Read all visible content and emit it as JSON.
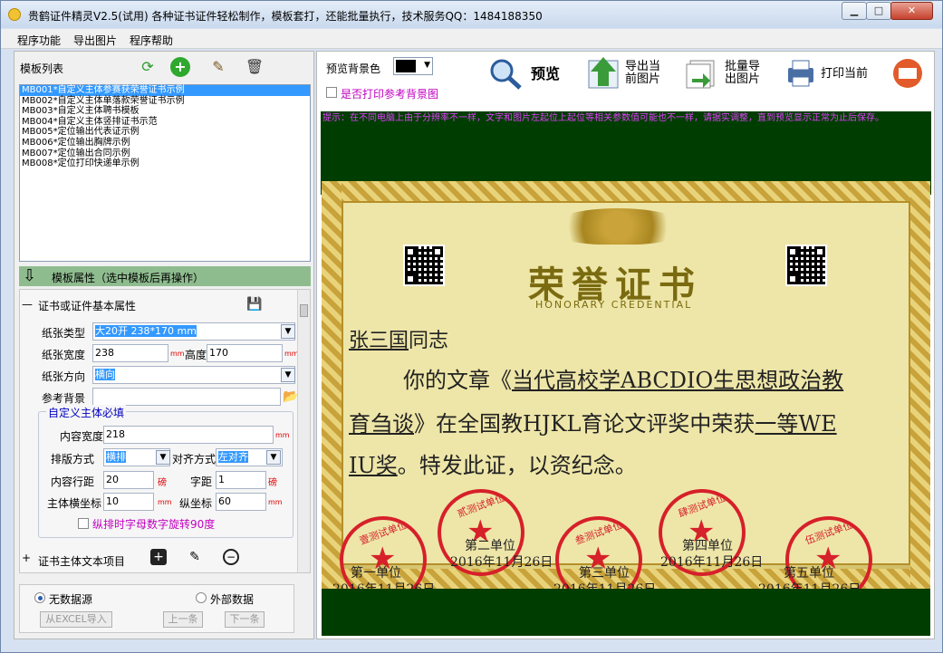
{
  "window": {
    "title": "贵鹤证件精灵V2.5(试用)     各种证书证件轻松制作，模板套打，还能批量执行，技术服务QQ：1484188350",
    "min": "▁",
    "max": "□",
    "close": "✕"
  },
  "menu": [
    "程序功能",
    "导出图片",
    "程序帮助"
  ],
  "templates": {
    "header": "模板列表",
    "items": [
      "MB001*自定义主体参赛获荣誉证书示例",
      "MB002*自定义主体单落款荣誉证书示例",
      "MB003*自定义主体聘书模板",
      "MB004*自定义主体竖排证书示范",
      "MB005*定位输出代表证示例",
      "MB006*定位输出胸牌示例",
      "MB007*定位输出合同示例",
      "MB008*定位打印快递单示例"
    ],
    "icons": [
      "refresh-icon",
      "add-icon",
      "edit-icon",
      "delete-icon"
    ]
  },
  "attr_bar": "模板属性（选中模板后再操作）",
  "props": {
    "section": "证书或证件基本属性",
    "paper_type_label": "纸张类型",
    "paper_type": "大20开 238*170 mm",
    "paper_width_label": "纸张宽度",
    "paper_width": "238",
    "height_label": "高度",
    "height": "170",
    "direction_label": "纸张方向",
    "direction": "横向",
    "ref_bg_label": "参考背景",
    "group_title": "自定义主体必填",
    "content_width_label": "内容宽度",
    "content_width": "218",
    "layout_label": "排版方式",
    "layout": "横排",
    "align_label": "对齐方式",
    "align": "左对齐",
    "line_space_label": "内容行距",
    "line_space": "20",
    "char_space_label": "字距",
    "char_space": "1",
    "x_label": "主体横坐标",
    "x": "10",
    "y_label": "纵坐标",
    "y": "60",
    "rotate_label": "纵排时字母数字旋转90度",
    "unit_mm": "mm",
    "unit_pound": "磅",
    "text_items": "证书主体文本项目"
  },
  "datasource": {
    "none": "无数据源",
    "external": "外部数据",
    "import": "从EXCEL导入",
    "prev": "上一条",
    "next": "下一条"
  },
  "right": {
    "bg_color_label": "预览背景色",
    "print_ref_label": "是否打印参考背景图",
    "preview": "预览",
    "export_current": "导出当前图片",
    "batch_export": "批量导出图片",
    "print_current": "打印当前",
    "hint": "提示：在不同电脑上由于分辨率不一样，文字和图片左起位上起位等相关参数值可能也不一样，请据实调整，直到预览显示正常为止后保存。"
  },
  "certificate": {
    "title": "荣誉证书",
    "subtitle": "HONORARY CREDENTIAL",
    "name": "张三国",
    "greeting": "同志",
    "line1a": "你的文章《",
    "article1": "当代高校学ABCDIO生思想政治教",
    "article2": "育刍谈",
    "line2b": "》在全国教HJKL育论文评奖中荣获",
    "award1": "一等WE",
    "award2": "IU奖",
    "line3b": "。特发此证，以资纪念。",
    "units": [
      "第一单位",
      "第二单位",
      "第三单位",
      "第四单位",
      "第五单位"
    ],
    "date": "2016年11月26日",
    "stamp_texts": [
      "壹测试单位",
      "贰测试单位",
      "叁测试单位",
      "肆测试单位",
      "伍测试单位"
    ]
  }
}
